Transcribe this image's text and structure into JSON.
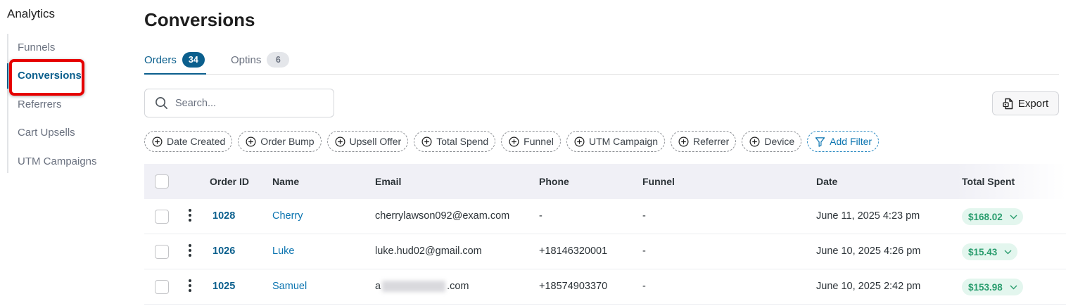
{
  "sidebar": {
    "title": "Analytics",
    "items": [
      {
        "label": "Funnels"
      },
      {
        "label": "Conversions"
      },
      {
        "label": "Referrers"
      },
      {
        "label": "Cart Upsells"
      },
      {
        "label": "UTM Campaigns"
      }
    ],
    "active": "Conversions"
  },
  "page": {
    "title": "Conversions"
  },
  "tabs": [
    {
      "label": "Orders",
      "count": "34"
    },
    {
      "label": "Optins",
      "count": "6"
    }
  ],
  "search": {
    "placeholder": "Search..."
  },
  "toolbar": {
    "export_label": "Export"
  },
  "filters": [
    {
      "label": "Date Created"
    },
    {
      "label": "Order Bump"
    },
    {
      "label": "Upsell Offer"
    },
    {
      "label": "Total Spend"
    },
    {
      "label": "Funnel"
    },
    {
      "label": "UTM Campaign"
    },
    {
      "label": "Referrer"
    },
    {
      "label": "Device"
    },
    {
      "label": "Add Filter"
    }
  ],
  "table": {
    "columns": [
      "Order ID",
      "Name",
      "Email",
      "Phone",
      "Funnel",
      "Date",
      "Total Spent"
    ],
    "rows": [
      {
        "order_id": "1028",
        "name": "Cherry",
        "email": "cherrylawson092@exam.com",
        "phone": "-",
        "funnel": "-",
        "date": "June 11, 2025 4:23 pm",
        "total": "$168.02"
      },
      {
        "order_id": "1026",
        "name": "Luke",
        "email": "luke.hud02@gmail.com",
        "phone": "+18146320001",
        "funnel": "-",
        "date": "June 10, 2025 4:26 pm",
        "total": "$15.43"
      },
      {
        "order_id": "1025",
        "name": "Samuel",
        "email_prefix": "a",
        "email_suffix": ".com",
        "phone": "+18574903370",
        "funnel": "-",
        "date": "June 10, 2025 2:42 pm",
        "total": "$153.98"
      }
    ]
  },
  "colors": {
    "accent": "#0b5f8d",
    "link": "#0b74b0",
    "highlight": "#e60000",
    "spent_bg": "#e3f6ee",
    "spent_text": "#2a9d6e"
  }
}
